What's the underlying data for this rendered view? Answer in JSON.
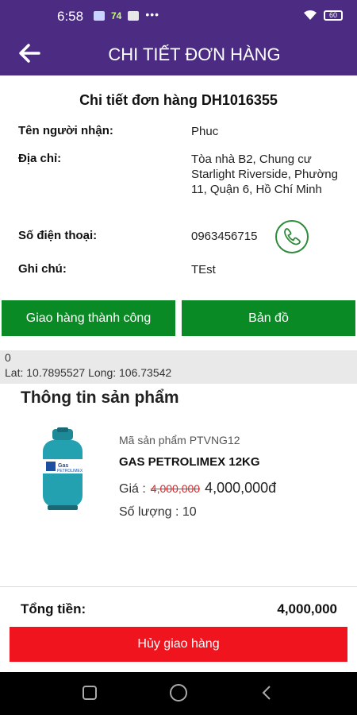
{
  "status_bar": {
    "time": "6:58",
    "notif_number": "74",
    "more": "•••",
    "battery": "60"
  },
  "app_bar": {
    "title": "CHI TIẾT ĐƠN HÀNG",
    "back_icon": "arrow-left"
  },
  "order": {
    "title": "Chi tiết đơn hàng DH1016355",
    "fields": [
      {
        "label": "Tên người nhận:",
        "value": "Phuc"
      },
      {
        "label": "Địa chỉ:",
        "value": "Tòa nhà B2, Chung cư Starlight Riverside, Phường 11, Quận 6, Hồ Chí Minh"
      },
      {
        "label": "Số điện thoại:",
        "value": "0963456715"
      },
      {
        "label": "Ghi chú:",
        "value": "TEst"
      }
    ]
  },
  "actions": {
    "delivered_label": "Giao hàng thành công",
    "map_label": "Bản đồ"
  },
  "location": {
    "line1": "0",
    "line2": "Lat: 10.7895527 Long: 106.73542"
  },
  "product_section": {
    "title": "Thông tin sản phẩm",
    "code": "Mã sản phẩm PTVNG12",
    "name": "GAS PETROLIMEX 12KG",
    "price_label": "Giá :",
    "old_price": "4,000,000",
    "new_price": "4,000,000đ",
    "quantity": "Số lượng : 10"
  },
  "summary": {
    "total_label": "Tổng tiền:",
    "total_value": "4,000,000"
  },
  "cancel_label": "Hủy giao hàng",
  "colors": {
    "header": "#4b2c82",
    "green": "#0a8a24",
    "red": "#f0141e"
  }
}
